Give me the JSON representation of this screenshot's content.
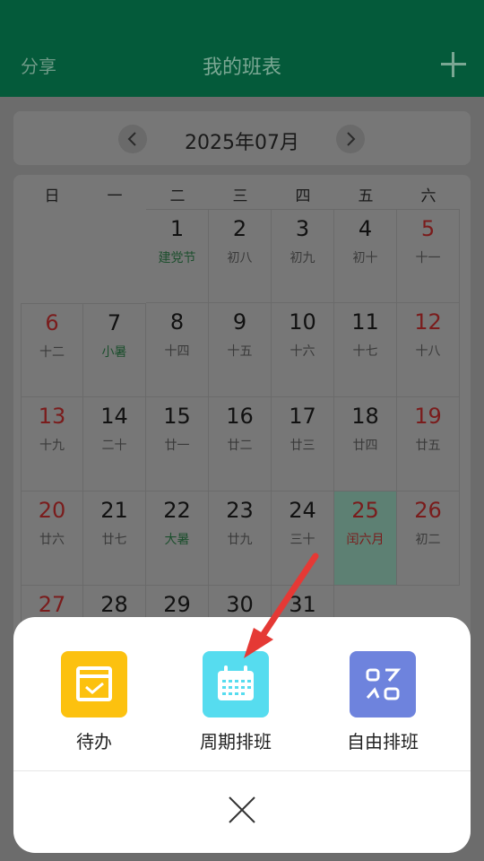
{
  "header": {
    "share": "分享",
    "title": "我的班表"
  },
  "month": {
    "label": "2025年07月"
  },
  "weekdays": [
    "日",
    "一",
    "二",
    "三",
    "四",
    "五",
    "六"
  ],
  "days": [
    {
      "n": "1",
      "s": "建党节"
    },
    {
      "n": "2",
      "s": "初八"
    },
    {
      "n": "3",
      "s": "初九"
    },
    {
      "n": "4",
      "s": "初十"
    },
    {
      "n": "5",
      "s": "十一"
    },
    {
      "n": "6",
      "s": "十二"
    },
    {
      "n": "7",
      "s": "小暑"
    },
    {
      "n": "8",
      "s": "十四"
    },
    {
      "n": "9",
      "s": "十五"
    },
    {
      "n": "10",
      "s": "十六"
    },
    {
      "n": "11",
      "s": "十七"
    },
    {
      "n": "12",
      "s": "十八"
    },
    {
      "n": "13",
      "s": "十九"
    },
    {
      "n": "14",
      "s": "二十"
    },
    {
      "n": "15",
      "s": "廿一"
    },
    {
      "n": "16",
      "s": "廿二"
    },
    {
      "n": "17",
      "s": "廿三"
    },
    {
      "n": "18",
      "s": "廿四"
    },
    {
      "n": "19",
      "s": "廿五"
    },
    {
      "n": "20",
      "s": "廿六"
    },
    {
      "n": "21",
      "s": "廿七"
    },
    {
      "n": "22",
      "s": "大暑"
    },
    {
      "n": "23",
      "s": "廿九"
    },
    {
      "n": "24",
      "s": "三十"
    },
    {
      "n": "25",
      "s": "闰六月"
    },
    {
      "n": "26",
      "s": "初二"
    },
    {
      "n": "27",
      "s": ""
    },
    {
      "n": "28",
      "s": ""
    },
    {
      "n": "29",
      "s": ""
    },
    {
      "n": "30",
      "s": ""
    },
    {
      "n": "31",
      "s": ""
    }
  ],
  "sheet": {
    "options": [
      {
        "label": "待办",
        "color": "#fcc10f"
      },
      {
        "label": "周期排班",
        "color": "#56dcef"
      },
      {
        "label": "自由排班",
        "color": "#6e83dd"
      }
    ]
  },
  "colors": {
    "header": "#045a3a",
    "arrow": "#e53935"
  }
}
